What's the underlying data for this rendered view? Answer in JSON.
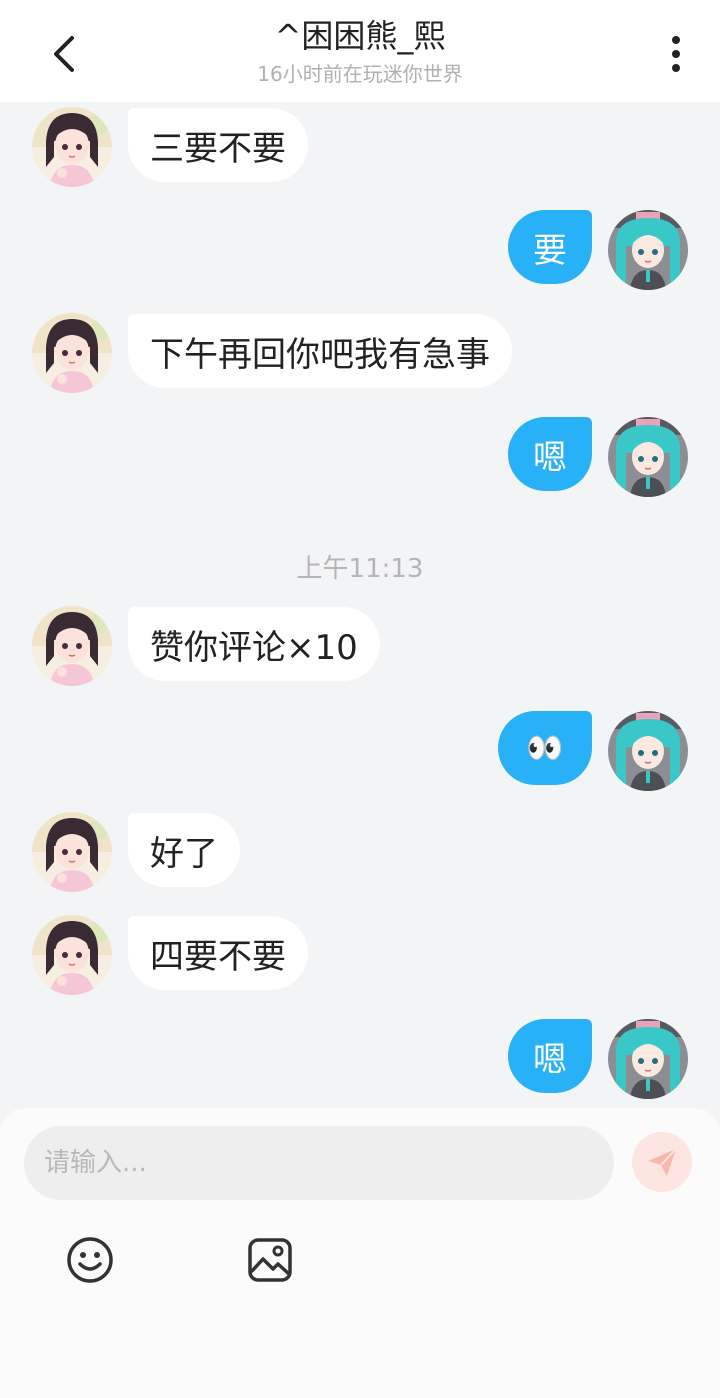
{
  "header": {
    "title": "^困困熊_熙",
    "subtitle": "16小时前在玩迷你世界",
    "back_icon": "chevron-left-icon",
    "more_icon": "more-vertical-icon"
  },
  "messages": [
    {
      "side": "in",
      "text": "三要不要"
    },
    {
      "side": "out",
      "text": "要"
    },
    {
      "side": "in",
      "text": "下午再回你吧我有急事"
    },
    {
      "side": "out",
      "text": "嗯"
    },
    {
      "side": "in",
      "text": "赞你评论×10"
    },
    {
      "side": "out",
      "text": "👀"
    },
    {
      "side": "in",
      "text": "好了"
    },
    {
      "side": "in",
      "text": "四要不要"
    },
    {
      "side": "out",
      "text": "嗯"
    }
  ],
  "timestamp": "上午11:13",
  "input": {
    "placeholder": "请输入..."
  },
  "toolbar": {
    "emoji_icon": "smiley-icon",
    "image_icon": "image-icon",
    "send_icon": "paper-plane-icon"
  },
  "colors": {
    "outgoing_bubble": "#28b1f6",
    "incoming_bubble": "#ffffff",
    "background": "#f3f4f6",
    "send_button": "#fde6e2"
  }
}
